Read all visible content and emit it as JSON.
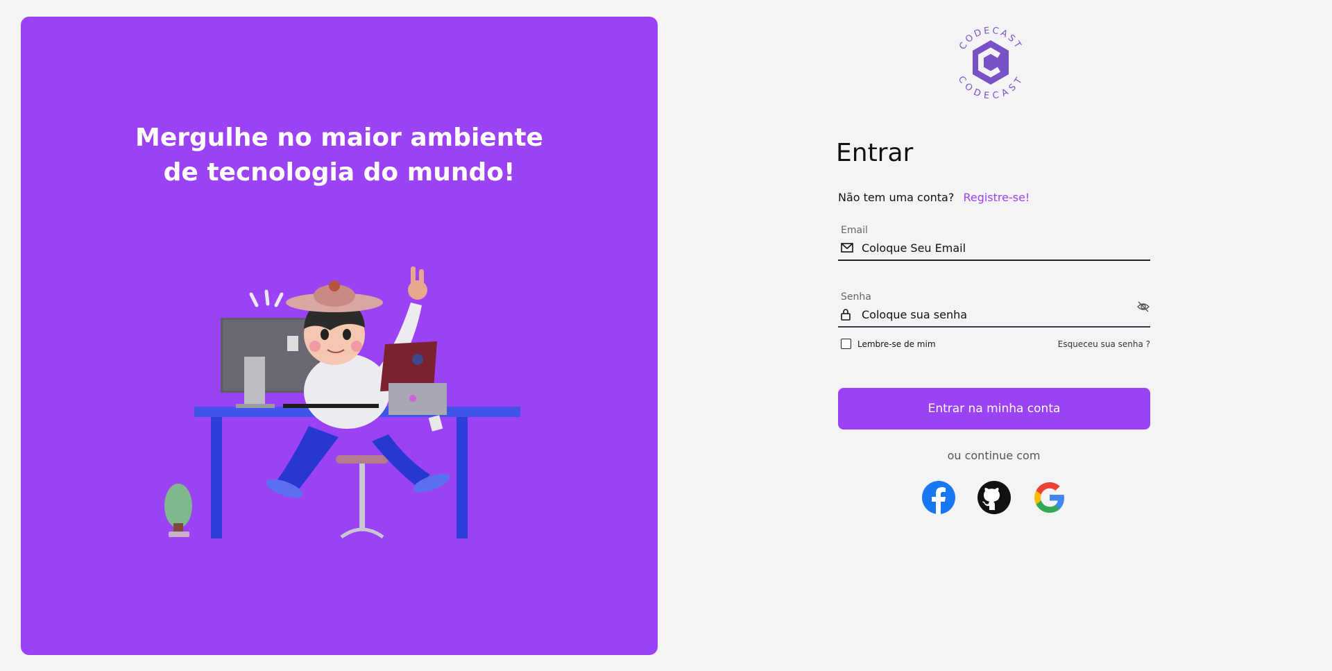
{
  "hero": {
    "title_line1": "Mergulhe no maior ambiente",
    "title_line2": "de tecnologia do mundo!",
    "illustration_icon": "developer-at-desk-illustration"
  },
  "brand": {
    "logo_text_top": "CODECAST",
    "logo_text_bottom": "CODECAST",
    "accent": "#9c42f5",
    "logo_color": "#7a52c7"
  },
  "login": {
    "heading": "Entrar",
    "no_account": "Não tem uma conta?",
    "register_link": "Registre-se!",
    "email": {
      "label": "Email",
      "placeholder": "Coloque Seu Email",
      "value": "",
      "icon": "envelope-icon"
    },
    "password": {
      "label": "Senha",
      "placeholder": "Coloque sua senha",
      "value": "",
      "icon": "lock-icon",
      "toggle_icon": "eye-off-icon"
    },
    "remember_me": "Lembre-se de mim",
    "remember_checked": false,
    "forgot_password": "Esqueceu sua senha ?",
    "submit_label": "Entrar na minha conta",
    "continue_with": "ou continue com",
    "social": [
      "facebook-icon",
      "github-icon",
      "google-icon"
    ]
  }
}
